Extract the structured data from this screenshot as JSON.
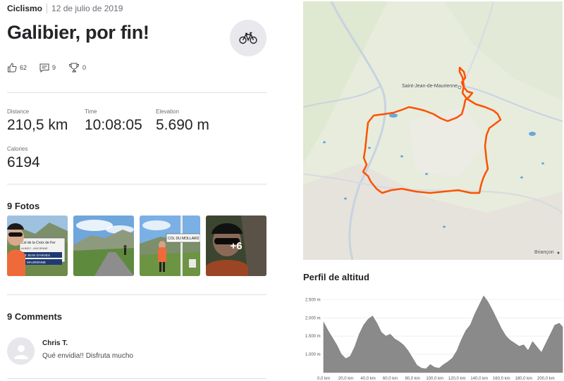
{
  "activity": {
    "sport": "Ciclismo",
    "date": "12 de julio de 2019",
    "title": "Galibier, por fin!",
    "sport_icon": "bicycle-icon"
  },
  "social": {
    "kudos": "62",
    "comments": "9",
    "achievements": "0"
  },
  "stats": {
    "distance": {
      "label": "Distance",
      "value": "210,5 km"
    },
    "time": {
      "label": "Time",
      "value": "10:08:05"
    },
    "elevation": {
      "label": "Elevation",
      "value": "5.690 m"
    },
    "calories": {
      "label": "Calories",
      "value": "6194"
    }
  },
  "photos": {
    "title": "9 Fotos",
    "more_label": "+6",
    "sign_texts": [
      "Col de la Croix de Fer",
      "ALBIEZ - ANCIENNE",
      "ST JEAN D'ARVES",
      "MAURIENNE",
      "COL DU MOLLARD"
    ]
  },
  "comments": {
    "title": "9 Comments",
    "items": [
      {
        "author": "Chris T.",
        "text": "Qué envidia!! Disfruta mucho"
      }
    ]
  },
  "map": {
    "labels": [
      "Saint-Jean-de-Maurienne",
      "Briançon"
    ],
    "route_color": "#fc5200"
  },
  "elevation_profile": {
    "title": "Perfil de altitud",
    "y_ticks": [
      "2.500 m",
      "2.000 m",
      "1.500 m",
      "1.000 m"
    ],
    "x_ticks": [
      "0,0 km",
      "20,0 km",
      "40,0 km",
      "60,0 km",
      "80,0 km",
      "100,0 km",
      "120,0 km",
      "140,0 km",
      "160,0 km",
      "180,0 km",
      "200,0 km"
    ]
  },
  "chart_data": {
    "type": "area",
    "title": "Perfil de altitud",
    "xlabel": "",
    "ylabel": "",
    "xlim": [
      0,
      215
    ],
    "ylim": [
      500,
      2700
    ],
    "x": [
      0,
      4,
      8,
      12,
      16,
      20,
      24,
      28,
      32,
      36,
      40,
      44,
      48,
      52,
      56,
      60,
      64,
      68,
      72,
      76,
      80,
      84,
      88,
      92,
      96,
      100,
      104,
      108,
      112,
      116,
      120,
      124,
      128,
      132,
      136,
      140,
      144,
      148,
      152,
      156,
      160,
      164,
      168,
      172,
      176,
      180,
      184,
      188,
      192,
      196,
      200,
      204,
      208,
      212,
      215
    ],
    "y": [
      1880,
      1650,
      1450,
      1250,
      1000,
      880,
      950,
      1200,
      1550,
      1800,
      1960,
      2050,
      1850,
      1600,
      1500,
      1550,
      1420,
      1350,
      1250,
      1100,
      900,
      700,
      620,
      600,
      720,
      640,
      620,
      720,
      800,
      900,
      1100,
      1400,
      1650,
      1800,
      2100,
      2350,
      2600,
      2430,
      2200,
      1950,
      1700,
      1500,
      1380,
      1300,
      1220,
      1260,
      1100,
      1350,
      1200,
      1050,
      1300,
      1550,
      1800,
      1850,
      1750
    ],
    "grid": true,
    "color": "#8a8a8a"
  }
}
